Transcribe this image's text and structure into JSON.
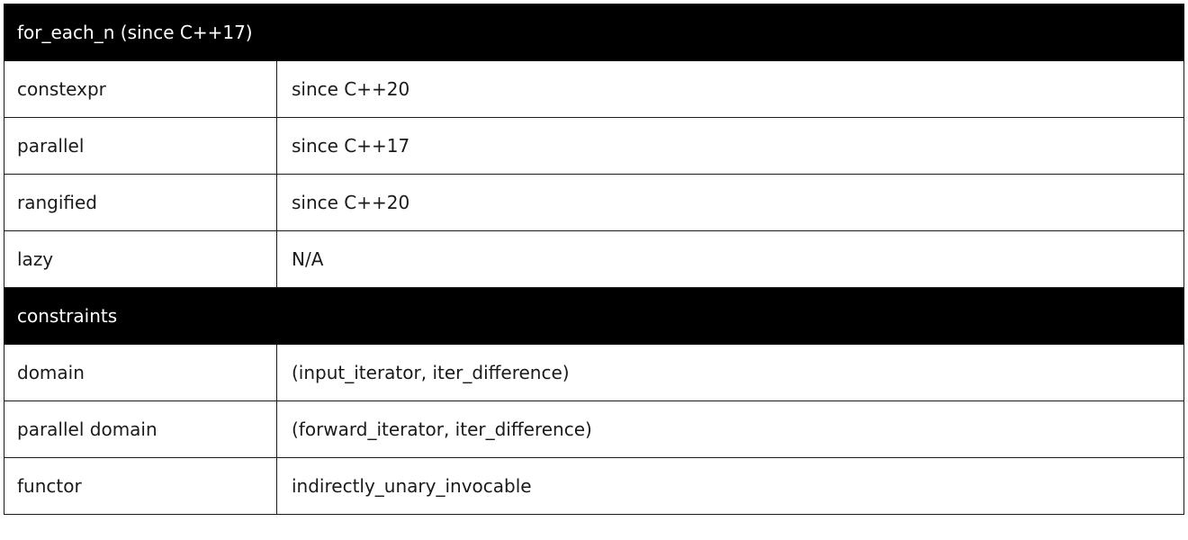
{
  "sections": [
    {
      "header": "for_each_n (since C++17)",
      "rows": [
        {
          "key": "constexpr",
          "value": "since C++20"
        },
        {
          "key": "parallel",
          "value": "since C++17"
        },
        {
          "key": "rangified",
          "value": "since C++20"
        },
        {
          "key": "lazy",
          "value": "N/A"
        }
      ]
    },
    {
      "header": "constraints",
      "rows": [
        {
          "key": "domain",
          "value": "(input_iterator, iter_difference)"
        },
        {
          "key": "parallel domain",
          "value": "(forward_iterator, iter_difference)"
        },
        {
          "key": "functor",
          "value": "indirectly_unary_invocable"
        }
      ]
    }
  ]
}
